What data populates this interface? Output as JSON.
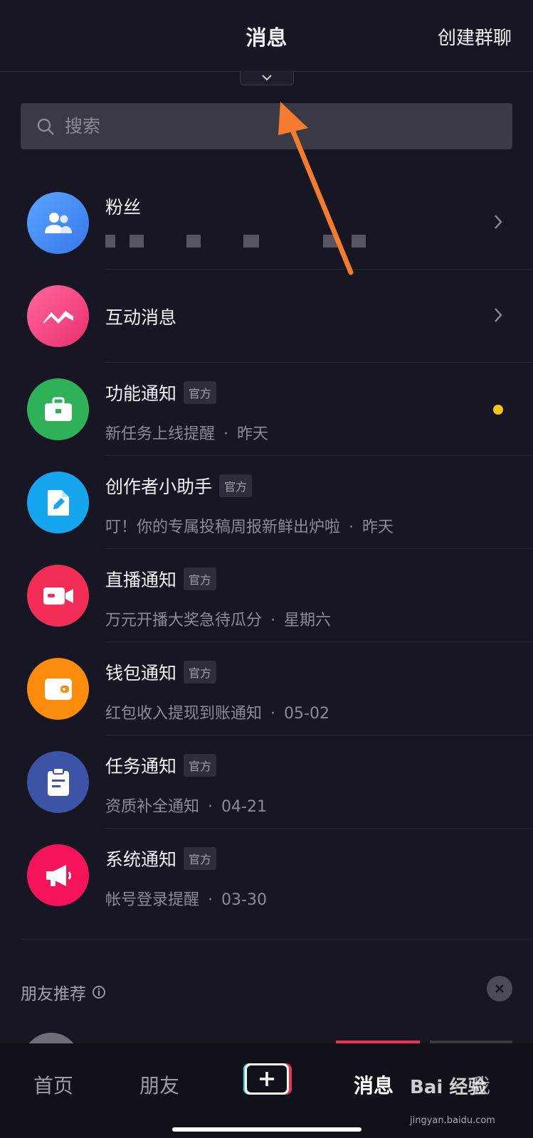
{
  "header": {
    "title": "消息",
    "create_group": "创建群聊"
  },
  "search": {
    "placeholder": "搜索"
  },
  "rows": [
    {
      "id": "fans",
      "title": "粉丝",
      "subtitle": "",
      "chevron": true
    },
    {
      "id": "interaction",
      "title": "互动消息",
      "chevron": true
    },
    {
      "id": "feature",
      "title": "功能通知",
      "badge": "官方",
      "subtitle": "新任务上线提醒",
      "time": "昨天",
      "unread": true
    },
    {
      "id": "creator",
      "title": "创作者小助手",
      "badge": "官方",
      "subtitle": "叮！你的专属投稿周报新鲜出炉啦",
      "time": "昨天"
    },
    {
      "id": "live",
      "title": "直播通知",
      "badge": "官方",
      "subtitle": "万元开播大奖急待瓜分",
      "time": "星期六"
    },
    {
      "id": "wallet",
      "title": "钱包通知",
      "badge": "官方",
      "subtitle": "红包收入提现到账通知",
      "time": "05-02"
    },
    {
      "id": "task",
      "title": "任务通知",
      "badge": "官方",
      "subtitle": "资质补全通知",
      "time": "04-21"
    },
    {
      "id": "system",
      "title": "系统通知",
      "badge": "官方",
      "subtitle": "帐号登录提醒",
      "time": "03-30"
    }
  ],
  "row_separator": "·",
  "friends": {
    "label": "朋友推荐"
  },
  "tabbar": {
    "home": "首页",
    "friends": "朋友",
    "messages": "消息",
    "me": "我"
  },
  "watermark": {
    "brand": "Bai 经验",
    "url": "jingyan.baidu.com"
  },
  "colors": {
    "fans": "#3d8ef0",
    "interaction": "#f0447f",
    "feature": "#2fb15a",
    "creator": "#16a6ef",
    "live": "#f22d56",
    "wallet": "#fb8c0c",
    "task": "#3d53a6",
    "system": "#f5135a",
    "unread": "#fac31f",
    "arrow": "#f57b2f"
  }
}
